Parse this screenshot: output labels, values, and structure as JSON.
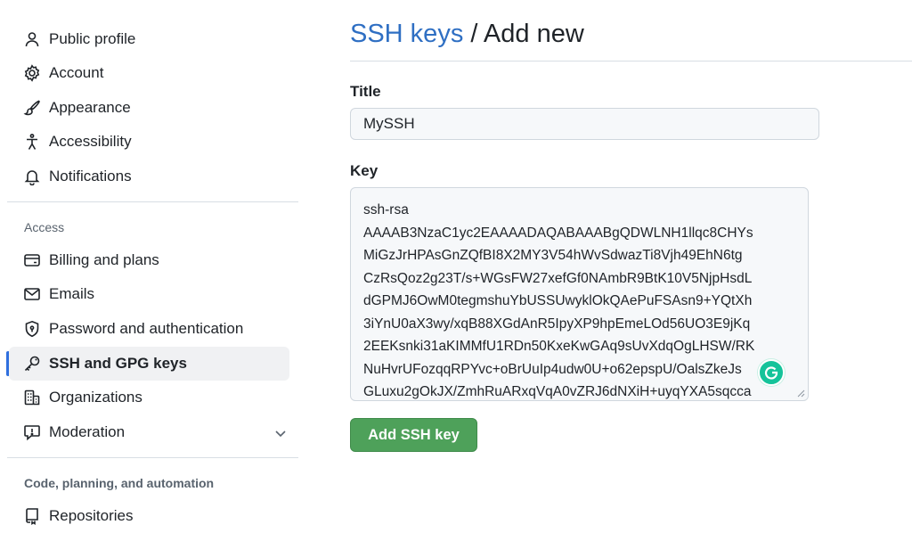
{
  "sidebar": {
    "top_items": [
      {
        "label": "Public profile",
        "icon": "person-icon"
      },
      {
        "label": "Account",
        "icon": "gear-icon"
      },
      {
        "label": "Appearance",
        "icon": "paintbrush-icon"
      },
      {
        "label": "Accessibility",
        "icon": "accessibility-icon"
      },
      {
        "label": "Notifications",
        "icon": "bell-icon"
      }
    ],
    "access_label": "Access",
    "access_items": [
      {
        "label": "Billing and plans",
        "icon": "credit-card-icon"
      },
      {
        "label": "Emails",
        "icon": "mail-icon"
      },
      {
        "label": "Password and authentication",
        "icon": "shield-lock-icon"
      },
      {
        "label": "SSH and GPG keys",
        "icon": "key-icon",
        "active": true
      },
      {
        "label": "Organizations",
        "icon": "organization-icon"
      },
      {
        "label": "Moderation",
        "icon": "report-icon",
        "expandable": true
      }
    ],
    "code_label": "Code, planning, and automation",
    "code_items": [
      {
        "label": "Repositories",
        "icon": "repo-icon"
      }
    ]
  },
  "main": {
    "breadcrumb_link": "SSH keys",
    "breadcrumb_sep": " / ",
    "breadcrumb_current": "Add new",
    "title_label": "Title",
    "title_value": "MySSH",
    "key_label": "Key",
    "key_lines": [
      "ssh-rsa",
      "AAAAB3NzaC1yc2EAAAADAQABAAABgQDWLNH1llqc8CHYs",
      "MiGzJrHPAsGnZQfBI8X2MY3V54hWvSdwazTi8Vjh49EhN6tg",
      "CzRsQoz2g23T/s+WGsFW27xefGf0NAmbR9BtK10V5NjpHsdL",
      "dGPMJ6OwM0tegmshuYbUSSUwyklOkQAePuFSAsn9+YQtXh",
      "3iYnU0aX3wy/xqB88XGdAnR5IpyXP9hpEmeLOd56UO3E9jKq",
      "2EEKsnki31aKIMMfU1RDn50KxeKwGAq9sUvXdqOgLHSW/RK",
      "NuHvrUFozqqRPYvc+oBrUuIp4udw0U+o62epspU/OalsZkeJs",
      "GLuxu2gOkJX/ZmhRuARxqVqA0vZRJ6dNXiH+uyqYXA5sqcca"
    ],
    "add_button": "Add SSH key"
  },
  "colors": {
    "link": "#2f6fc3",
    "button": "#4ea15a",
    "active_indicator": "#2f6fde"
  }
}
